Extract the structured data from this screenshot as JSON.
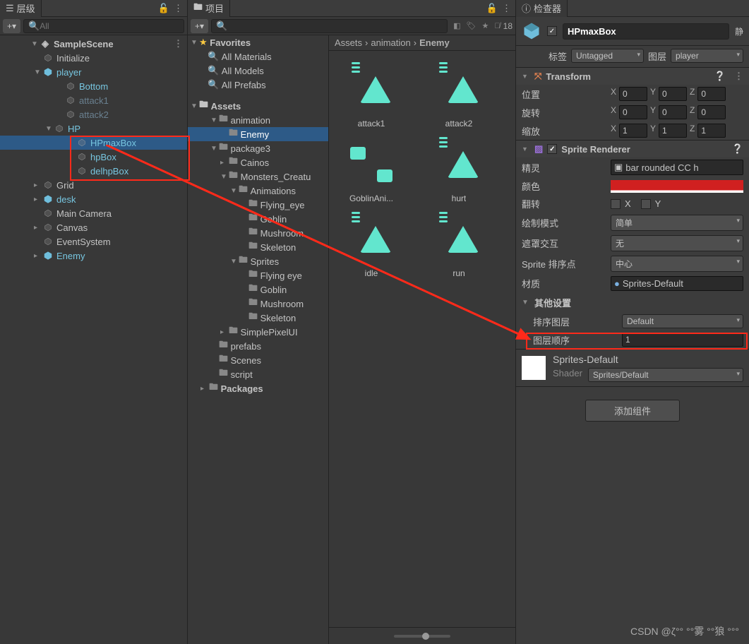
{
  "hierarchy": {
    "title": "层级",
    "search_placeholder": "All",
    "scene": "SampleScene",
    "nodes": [
      {
        "label": "Initialize",
        "ind": 3,
        "color": ""
      },
      {
        "label": "player",
        "ind": 3,
        "color": "blue-link",
        "expand": "▼",
        "prefab": true
      },
      {
        "label": "Bottom",
        "ind": 5,
        "color": "blue-link"
      },
      {
        "label": "attack1",
        "ind": 5,
        "color": "greyed"
      },
      {
        "label": "attack2",
        "ind": 5,
        "color": "greyed"
      },
      {
        "label": "HP",
        "ind": 4,
        "color": "blue-link",
        "expand": "▼"
      },
      {
        "label": "HPmaxBox",
        "ind": 6,
        "color": "blue-link",
        "selected": true
      },
      {
        "label": "hpBox",
        "ind": 6,
        "color": "blue-link"
      },
      {
        "label": "delhpBox",
        "ind": 6,
        "color": "blue-link"
      },
      {
        "label": "Grid",
        "ind": 3,
        "color": "",
        "expand": "▸"
      },
      {
        "label": "desk",
        "ind": 3,
        "color": "blue-link",
        "expand": "▸",
        "prefab": true
      },
      {
        "label": "Main Camera",
        "ind": 3,
        "color": ""
      },
      {
        "label": "Canvas",
        "ind": 3,
        "color": "",
        "expand": "▸"
      },
      {
        "label": "EventSystem",
        "ind": 3,
        "color": ""
      },
      {
        "label": "Enemy",
        "ind": 3,
        "color": "blue-link",
        "expand": "▸",
        "prefab": true
      }
    ]
  },
  "project": {
    "title": "项目",
    "hidden_count": "18",
    "favorites_label": "Favorites",
    "favorites": [
      "All Materials",
      "All Models",
      "All Prefabs"
    ],
    "assets_label": "Assets",
    "tree": [
      {
        "label": "animation",
        "ind": 2,
        "expand": "▼",
        "type": "folder"
      },
      {
        "label": "Enemy",
        "ind": 3,
        "type": "folder-sel"
      },
      {
        "label": "package3",
        "ind": 2,
        "expand": "▼",
        "type": "folder"
      },
      {
        "label": "Cainos",
        "ind": 3,
        "type": "folder",
        "expand": "▸"
      },
      {
        "label": "Monsters_Creatu",
        "ind": 3,
        "expand": "▼",
        "type": "folder"
      },
      {
        "label": "Animations",
        "ind": 4,
        "expand": "▼",
        "type": "folder"
      },
      {
        "label": "Flying_eye",
        "ind": 5,
        "type": "folder"
      },
      {
        "label": "Goblin",
        "ind": 5,
        "type": "folder"
      },
      {
        "label": "Mushroom",
        "ind": 5,
        "type": "folder"
      },
      {
        "label": "Skeleton",
        "ind": 5,
        "type": "folder"
      },
      {
        "label": "Sprites",
        "ind": 4,
        "expand": "▼",
        "type": "folder"
      },
      {
        "label": "Flying eye",
        "ind": 5,
        "type": "folder"
      },
      {
        "label": "Goblin",
        "ind": 5,
        "type": "folder"
      },
      {
        "label": "Mushroom",
        "ind": 5,
        "type": "folder"
      },
      {
        "label": "Skeleton",
        "ind": 5,
        "type": "folder"
      },
      {
        "label": "SimplePixelUI",
        "ind": 3,
        "type": "folder",
        "expand": "▸"
      },
      {
        "label": "prefabs",
        "ind": 2,
        "type": "folder"
      },
      {
        "label": "Scenes",
        "ind": 2,
        "type": "folder"
      },
      {
        "label": "script",
        "ind": 2,
        "type": "folder"
      },
      {
        "label": "Packages",
        "ind": 1,
        "type": "folder",
        "expand": "▸",
        "bold": true
      }
    ],
    "breadcrumb": [
      "Assets",
      "animation",
      "Enemy"
    ],
    "assets": [
      {
        "label": "attack1",
        "type": "anim"
      },
      {
        "label": "attack2",
        "type": "anim"
      },
      {
        "label": "GoblinAni...",
        "type": "ctrl"
      },
      {
        "label": "hurt",
        "type": "anim"
      },
      {
        "label": "idle",
        "type": "anim"
      },
      {
        "label": "run",
        "type": "anim"
      }
    ]
  },
  "inspector": {
    "title": "检查器",
    "object_name": "HPmaxBox",
    "static_label": "静",
    "tag_label": "标签",
    "tag_value": "Untagged",
    "layer_label": "图层",
    "layer_value": "player",
    "transform": {
      "header": "Transform",
      "position_label": "位置",
      "rotation_label": "旋转",
      "scale_label": "缩放",
      "pos": {
        "x": "0",
        "y": "0",
        "z": "0"
      },
      "rot": {
        "x": "0",
        "y": "0",
        "z": "0"
      },
      "scl": {
        "x": "1",
        "y": "1",
        "z": "1"
      }
    },
    "sprite_renderer": {
      "header": "Sprite Renderer",
      "sprite_label": "精灵",
      "sprite_value": "bar rounded CC h",
      "color_label": "颜色",
      "flip_label": "翻转",
      "flip_x": "X",
      "flip_y": "Y",
      "draw_mode_label": "绘制模式",
      "draw_mode_value": "简单",
      "mask_label": "遮罩交互",
      "mask_value": "无",
      "sort_point_label": "Sprite 排序点",
      "sort_point_value": "中心",
      "material_label": "材质",
      "material_value": "Sprites-Default",
      "other_settings": "其他设置",
      "sorting_layer_label": "排序图层",
      "sorting_layer_value": "Default",
      "order_label": "图层顺序",
      "order_value": "1"
    },
    "material": {
      "name": "Sprites-Default",
      "shader_label": "Shader",
      "shader_value": "Sprites/Default"
    },
    "add_component": "添加组件"
  },
  "watermark": "CSDN @ζ°° °°雾  °°狼  °°°"
}
